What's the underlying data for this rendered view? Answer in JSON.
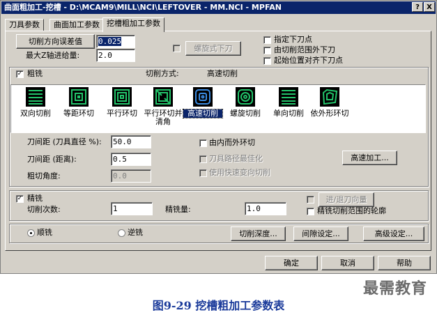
{
  "window": {
    "title": "曲面粗加工-挖槽 - D:\\MCAM9\\MILL\\NCI\\LEFTOVER - MM.NCI - MPFAN",
    "help_label": "?",
    "close_label": "X"
  },
  "tabs": [
    "刀具参数",
    "曲面加工参数",
    "挖槽粗加工参数"
  ],
  "top": {
    "cut_tolerance_button": "切削方向误差值",
    "cut_tolerance_value": "0.025",
    "max_z_step_label": "最大Z轴进给量:",
    "max_z_step_value": "2.0",
    "helix_button": "螺旋式下刀",
    "options": [
      {
        "label": "指定下刀点",
        "checked": false
      },
      {
        "label": "由切削范围外下刀",
        "checked": false
      },
      {
        "label": "起始位置对齐下刀点",
        "checked": false
      }
    ]
  },
  "roughing": {
    "label": "粗铣",
    "checked": true,
    "cut_method_label": "切削方式:",
    "cut_method_value": "高速切削",
    "methods": [
      {
        "label": "双向切削",
        "icon": "zigzag-icon"
      },
      {
        "label": "等距环切",
        "icon": "constant-overlap-spiral-icon"
      },
      {
        "label": "平行环切",
        "icon": "parallel-spiral-icon"
      },
      {
        "label": "平行环切并",
        "label2": "清角",
        "icon": "parallel-spiral-clean-corners-icon"
      },
      {
        "label": "高速切削",
        "icon": "high-speed-icon",
        "selected": true
      },
      {
        "label": "螺旋切削",
        "icon": "true-spiral-icon"
      },
      {
        "label": "单向切削",
        "icon": "one-way-icon"
      },
      {
        "label": "依外形环切",
        "icon": "morph-spiral-icon"
      }
    ],
    "stepover_pct_label": "刀间距 (刀具直径 %):",
    "stepover_pct_value": "50.0",
    "stepover_dist_label": "刀间距 (距离):",
    "stepover_dist_value": "0.5",
    "rough_angle_label": "粗切角度:",
    "rough_angle_value": "0.0",
    "spiral_inside_out": "由内而外环切",
    "minimize_tool_burial": "刀具路径最佳化",
    "quick_zigzag": "使用快速变向切削",
    "high_speed_button": "高速加工..."
  },
  "finishing": {
    "label": "精铣",
    "checked": true,
    "passes_label": "切削次数:",
    "passes_value": "1",
    "spacing_label": "精铣量:",
    "spacing_value": "1.0",
    "lead_button": "进/退刀向量",
    "contour_option": "精铣切削范围的轮廓"
  },
  "bottom": {
    "climb": "顺铣",
    "conventional": "逆铣",
    "depth_button": "切削深度...",
    "gap_button": "间隙设定...",
    "advanced_button": "高级设定..."
  },
  "footer": {
    "ok": "确定",
    "cancel": "取消",
    "help": "帮助"
  },
  "caption": "图9-29 挖槽粗加工参数表",
  "watermark": "最需教育",
  "colors": {
    "titlebar": "#0a246a",
    "dialog_bg": "#d4d0c8",
    "icon_green": "#22c46a",
    "caption": "#1a3a9a"
  }
}
